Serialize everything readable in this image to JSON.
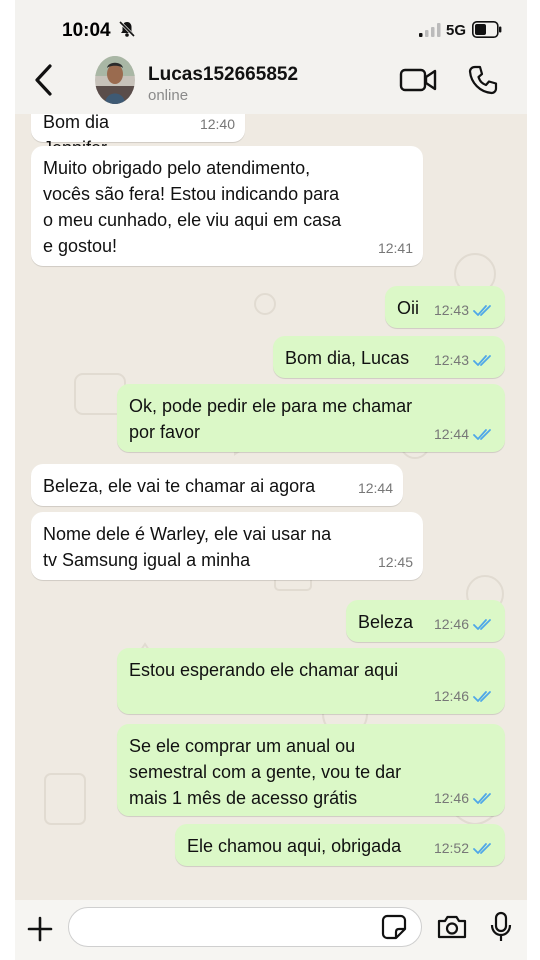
{
  "status_bar": {
    "time": "10:04",
    "network": "5G"
  },
  "header": {
    "contact_name": "Lucas152665852",
    "contact_status": "online"
  },
  "messages": [
    {
      "dir": "in",
      "text": "Bom dia Jennifer",
      "time": "12:40"
    },
    {
      "dir": "in",
      "text": "Muito obrigado pelo atendimento, vocês são fera! Estou indicando para o meu cunhado, ele viu aqui em casa e gostou!",
      "time": "12:41"
    },
    {
      "dir": "out",
      "text": "Oii",
      "time": "12:43",
      "read": true
    },
    {
      "dir": "out",
      "text": "Bom dia, Lucas",
      "time": "12:43",
      "read": true
    },
    {
      "dir": "out",
      "text": "Ok, pode pedir ele para me chamar por favor",
      "time": "12:44",
      "read": true
    },
    {
      "dir": "in",
      "text": "Beleza, ele vai te chamar ai agora",
      "time": "12:44"
    },
    {
      "dir": "in",
      "text": "Nome dele é Warley, ele vai usar na tv Samsung igual a minha",
      "time": "12:45"
    },
    {
      "dir": "out",
      "text": "Beleza",
      "time": "12:46",
      "read": true
    },
    {
      "dir": "out",
      "text": "Estou esperando ele chamar aqui",
      "time": "12:46",
      "read": true
    },
    {
      "dir": "out",
      "text": "Se ele comprar um anual ou semestral com a gente, vou te dar mais 1 mês de acesso grátis",
      "time": "12:46",
      "read": true
    },
    {
      "dir": "out",
      "text": "Ele chamou aqui, obrigada",
      "time": "12:52",
      "read": true
    }
  ],
  "composer": {
    "message_value": ""
  },
  "colors": {
    "outgoing_bubble": "#dbf8c7",
    "incoming_bubble": "#ffffff",
    "read_ticks": "#4fa7e8",
    "chat_background": "#efeae2"
  },
  "icons": [
    "back-icon",
    "video-call-icon",
    "voice-call-icon",
    "plus-icon",
    "sticker-icon",
    "camera-icon",
    "microphone-icon",
    "bell-off-icon",
    "signal-icon",
    "battery-icon"
  ]
}
